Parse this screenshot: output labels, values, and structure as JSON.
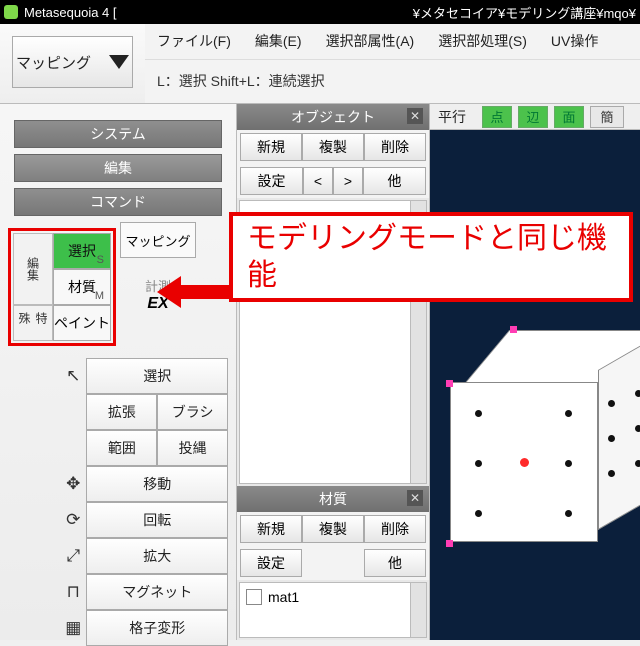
{
  "titlebar": {
    "app": "Metasequoia 4 [",
    "path": "¥メタセコイア¥モデリング講座¥mqo¥"
  },
  "mode": {
    "label": "マッピング"
  },
  "menu": {
    "file": "ファイル(F)",
    "edit": "編集(E)",
    "selattr": "選択部属性(A)",
    "selproc": "選択部処理(S)",
    "uvop": "UV操作"
  },
  "hint": "L：選択  Shift+L：連続選択",
  "left": {
    "system": "システム",
    "edit": "編集",
    "command": "コマンド",
    "grp_edit": "編集",
    "grp_special": "特殊",
    "cmd_select": "選択",
    "cmd_select_sub": "S",
    "cmd_material": "材質",
    "cmd_material_sub": "M",
    "cmd_paint": "ペイント",
    "side_mapping": "マッピング",
    "side_measure": "計測",
    "side_ex": "EX",
    "t_select": "選択",
    "t_extend": "拡張",
    "t_brush": "ブラシ",
    "t_range": "範囲",
    "t_lasso": "投縄",
    "t_move": "移動",
    "t_rotate": "回転",
    "t_scale": "拡大",
    "t_magnet": "マグネット",
    "t_lattice": "格子変形"
  },
  "object_panel": {
    "title": "オブジェクト",
    "new": "新規",
    "dup": "複製",
    "del": "削除",
    "set": "設定",
    "lt": "<",
    "gt": ">",
    "other": "他"
  },
  "material_panel": {
    "title": "材質",
    "new": "新規",
    "dup": "複製",
    "del": "削除",
    "set": "設定",
    "other": "他",
    "items": [
      {
        "name": "mat1"
      }
    ]
  },
  "viewport": {
    "proj": "平行",
    "pt": "点",
    "edge": "辺",
    "face": "面",
    "simple": "簡"
  },
  "callout": {
    "text": "モデリングモードと同じ機能"
  },
  "icons": {
    "cursor": "↖",
    "move": "✥",
    "rotate": "⟳",
    "scale": "⤢",
    "magnet": "⊓",
    "lattice": "▦",
    "close": "✕"
  }
}
